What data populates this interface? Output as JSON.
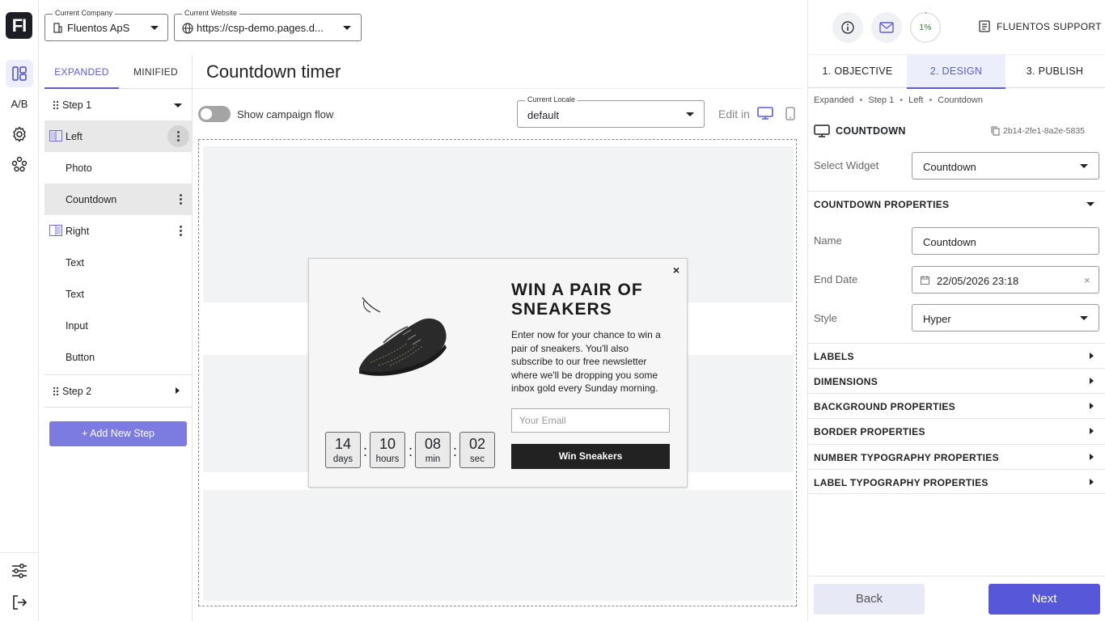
{
  "rail": {
    "logo": "FI",
    "ab": "A/B"
  },
  "topbar": {
    "company": {
      "label": "Current Company",
      "value": "Fluentos ApS"
    },
    "website": {
      "label": "Current Website",
      "value": "https://csp-demo.pages.d..."
    }
  },
  "tree": {
    "tabs": {
      "expanded": "EXPANDED",
      "minified": "MINIFIED"
    },
    "items": [
      {
        "label": "Step 1"
      },
      {
        "label": "Left"
      },
      {
        "label": "Photo"
      },
      {
        "label": "Countdown"
      },
      {
        "label": "Right"
      },
      {
        "label": "Text"
      },
      {
        "label": "Text"
      },
      {
        "label": "Input"
      },
      {
        "label": "Button"
      },
      {
        "label": "Step 2"
      }
    ],
    "add_step": "+ Add New Step"
  },
  "center": {
    "title": "Countdown timer",
    "toggle_label": "Show campaign flow",
    "locale": {
      "label": "Current Locale",
      "value": "default"
    },
    "edit_in": "Edit in"
  },
  "popup": {
    "close": "×",
    "title": "WIN A PAIR OF SNEAKERS",
    "body": "Enter now for your chance to win a pair of sneakers. You'll also subscribe to our free newsletter where we'll be dropping you some inbox gold every Sunday morning.",
    "email_placeholder": "Your Email",
    "button": "Win Sneakers",
    "countdown": [
      {
        "value": "14",
        "unit": "days"
      },
      {
        "value": "10",
        "unit": "hours"
      },
      {
        "value": "08",
        "unit": "min"
      },
      {
        "value": "02",
        "unit": "sec"
      }
    ]
  },
  "right": {
    "progress": "1%",
    "support": "FLUENTOS SUPPORT",
    "steps": [
      "1. OBJECTIVE",
      "2. DESIGN",
      "3. PUBLISH"
    ],
    "breadcrumb": [
      "Expanded",
      "Step 1",
      "Left",
      "Countdown"
    ],
    "widget_title": "COUNTDOWN",
    "widget_id": "2b14-2fe1-8a2e-5835",
    "select_widget": {
      "label": "Select Widget",
      "value": "Countdown"
    },
    "props_title": "COUNTDOWN PROPERTIES",
    "name": {
      "label": "Name",
      "value": "Countdown"
    },
    "end_date": {
      "label": "End Date",
      "value": "22/05/2026 23:18"
    },
    "style": {
      "label": "Style",
      "value": "Hyper"
    },
    "sections": [
      "LABELS",
      "DIMENSIONS",
      "BACKGROUND PROPERTIES",
      "BORDER PROPERTIES",
      "NUMBER TYPOGRAPHY PROPERTIES",
      "LABEL TYPOGRAPHY PROPERTIES"
    ],
    "back": "Back",
    "next": "Next"
  },
  "colors": {
    "accent": "#5b5bd6",
    "dark": "#1d1d26"
  }
}
